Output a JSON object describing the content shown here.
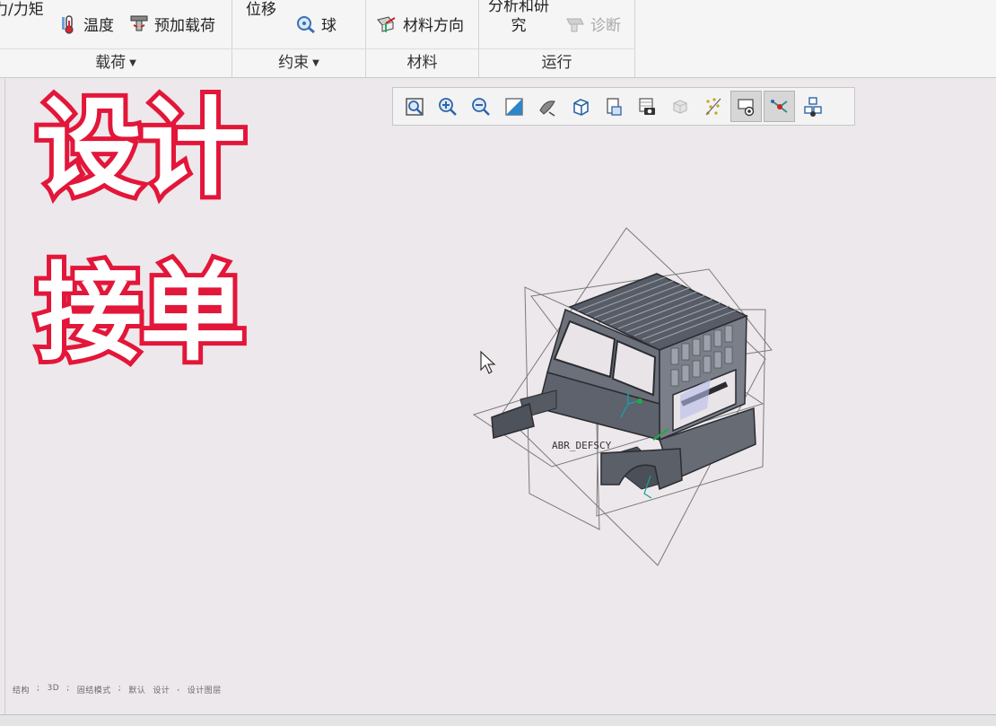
{
  "ribbon": {
    "groups": [
      {
        "label": "载荷",
        "has_dropdown": true
      },
      {
        "label": "约束",
        "has_dropdown": true
      },
      {
        "label": "材料",
        "has_dropdown": false
      },
      {
        "label": "运行",
        "has_dropdown": false
      }
    ],
    "buttons": {
      "force_moment": "力/力矩",
      "temperature": "温度",
      "preload": "预加载荷",
      "displacement": "位移",
      "ball": "球",
      "material_orientation": "材料方向",
      "analyses_studies_line1": "分析和研",
      "analyses_studies_line2": "究",
      "diagnostics": "诊断"
    }
  },
  "overlay_text": {
    "line1": "设计",
    "line2": "接单"
  },
  "model": {
    "csys_label": "ABR_DEFSCY"
  },
  "status_bar": {
    "items": [
      "结构",
      ";",
      "3D",
      ";",
      "固结模式",
      ";",
      "默认",
      "设计",
      ",",
      "设计图层"
    ]
  }
}
